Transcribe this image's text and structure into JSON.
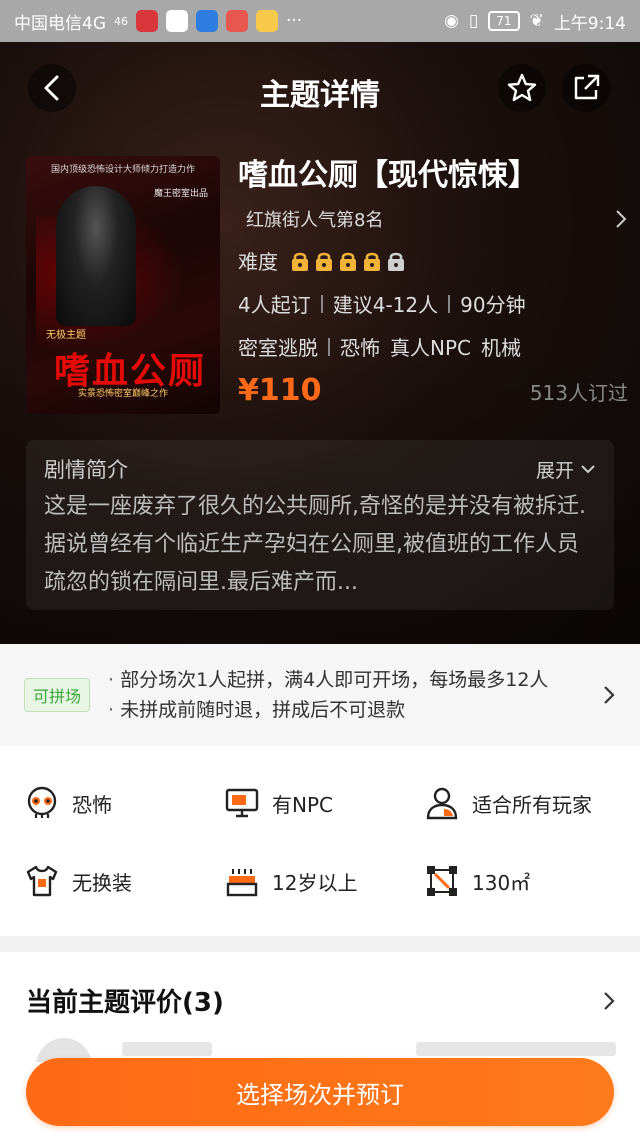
{
  "statusbar": {
    "carrier": "中国电信4G",
    "signal": "46",
    "battery": "71",
    "time": "上午9:14"
  },
  "nav": {
    "title": "主题详情",
    "back_icon": "chevron-left-icon",
    "favorite_icon": "star-icon",
    "share_icon": "share-icon"
  },
  "poster": {
    "top_caption": "国内顶级恐怖设计大师倾力打造力作",
    "studio": "魔王密室出品",
    "theme_tag": "无极主题",
    "name": "嗜血公厕",
    "subtitle": "实景恐怖密室巅峰之作"
  },
  "theme": {
    "name": "嗜血公厕【现代惊悚】",
    "rank": "红旗街人气第8名",
    "difficulty_label": "难度",
    "difficulty": {
      "filled": 4,
      "total": 5
    },
    "meta": [
      "4人起订",
      "建议4-12人",
      "90分钟"
    ],
    "tags": [
      "密室逃脱",
      "恐怖",
      "真人NPC",
      "机械"
    ],
    "price": "¥110",
    "booked": "513人订过"
  },
  "plot": {
    "title": "剧情简介",
    "expand_label": "展开",
    "text": "这是一座废弃了很久的公共厕所,奇怪的是并没有被拆迁. 据说曾经有个临近生产孕妇在公厕里,被值班的工作人员疏忽的锁在隔间里.最后难产而..."
  },
  "pin": {
    "badge": "可拼场",
    "line1": "部分场次1人起拼，满4人即可开场，每场最多12人",
    "line2": "未拼成前随时退，拼成后不可退款"
  },
  "features": [
    {
      "label": "恐怖",
      "icon": "skull-icon"
    },
    {
      "label": "有NPC",
      "icon": "monitor-person-icon"
    },
    {
      "label": "适合所有玩家",
      "icon": "person-icon"
    },
    {
      "label": "无换装",
      "icon": "shirt-icon"
    },
    {
      "label": "12岁以上",
      "icon": "cake-icon"
    },
    {
      "label": "130㎡",
      "icon": "area-icon"
    }
  ],
  "reviews": {
    "title": "当前主题评价(3)"
  },
  "cta": {
    "label": "选择场次并预订"
  },
  "colors": {
    "accent": "#ff6a14",
    "price": "#ff6a1a",
    "lock": "#f2b33a",
    "pin_green": "#3aa83a"
  }
}
